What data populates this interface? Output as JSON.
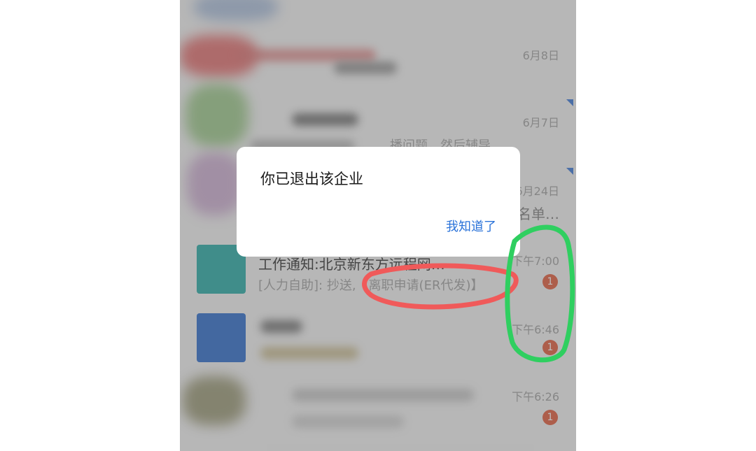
{
  "chat_list": {
    "items": [
      {
        "time": "6月8日",
        "badge": ""
      },
      {
        "time": "6月7日",
        "snippet": "播问题，然后辅导…",
        "badge": ""
      },
      {
        "time": "6月24日",
        "snippet": "名单…",
        "badge": ""
      },
      {
        "time": "下午7:00",
        "title": "工作通知:北京新东方远程网…",
        "snippet_prefix": "[人力自助]: 抄送,",
        "snippet_highlight": "【离职申请(ER代发)】",
        "badge": "1"
      },
      {
        "time": "下午6:46",
        "badge": "1"
      },
      {
        "time": "下午6:26",
        "badge": "1"
      }
    ]
  },
  "dialog": {
    "message": "你已退出该企业",
    "confirm_label": "我知道了"
  },
  "colors": {
    "badge": "#e0502e",
    "link": "#2b73d9",
    "annotation_red": "#f05a5a",
    "annotation_green": "#2fcf60"
  },
  "icons": [
    "list-item-corner-marker-icon",
    "unread-badge"
  ]
}
